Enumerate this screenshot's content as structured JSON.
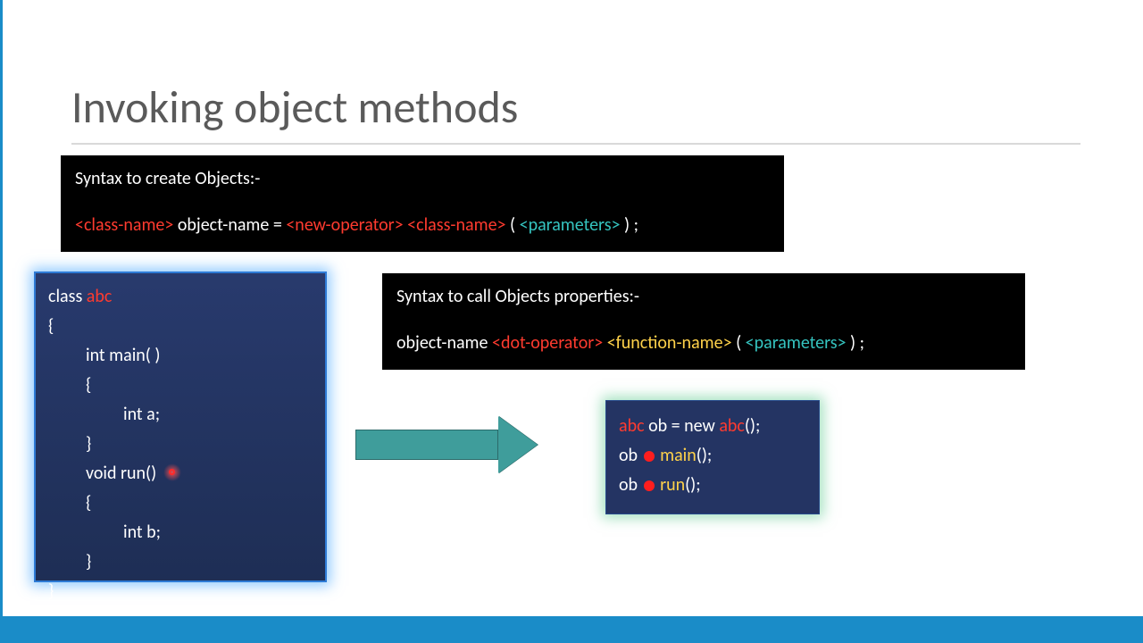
{
  "title": "Invoking object methods",
  "box1": {
    "heading": "Syntax to create Objects:-",
    "classname_tag": "<class-name>",
    "text1": " object-name = ",
    "newop_tag": "<new-operator>",
    "space": " ",
    "classname_tag2": "<class-name>",
    "open_paren": " ( ",
    "params_tag": "<parameters>",
    "close_paren": " ) ;"
  },
  "box2": {
    "heading": "Syntax to call Objects properties:-",
    "text1": "object-name ",
    "dotop_tag": "<dot-operator>",
    "space": " ",
    "func_tag": "<function-name>",
    "open_paren": " ( ",
    "params_tag": "<parameters>",
    "close_paren": " ) ;"
  },
  "code": {
    "l1_pre": "class ",
    "l1_class": "abc",
    "l2": "{",
    "l3": "int main( )",
    "l4": "{",
    "l5": "int a;",
    "l6": "}",
    "l7": "void run()",
    "l8": "{",
    "l9": "int b;",
    "l10": "}",
    "l11": "}"
  },
  "invoke": {
    "l1_class1": "abc",
    "l1_mid": " ob = new ",
    "l1_class2": "abc",
    "l1_end": "();",
    "l2_pre": "ob ",
    "l2_method": " main",
    "l2_end": "();",
    "l3_pre": "ob ",
    "l3_method": " run",
    "l3_end": "();"
  }
}
